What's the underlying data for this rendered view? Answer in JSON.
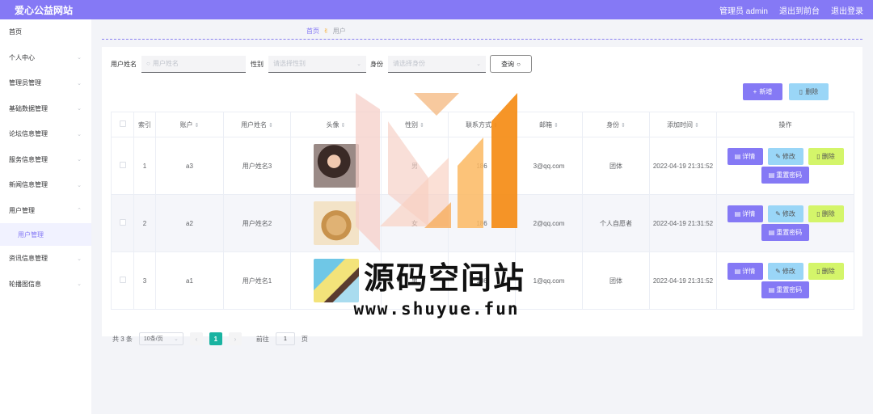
{
  "header": {
    "site_title": "爱心公益网站",
    "admin": "管理员 admin",
    "to_front": "退出到前台",
    "logout": "退出登录"
  },
  "sidebar": {
    "items": [
      {
        "label": "首页"
      },
      {
        "label": "个人中心"
      },
      {
        "label": "管理员管理"
      },
      {
        "label": "基础数据管理"
      },
      {
        "label": "论坛信息管理"
      },
      {
        "label": "服务信息管理"
      },
      {
        "label": "新闻信息管理"
      },
      {
        "label": "用户管理"
      },
      {
        "label": "用户管理"
      },
      {
        "label": "资讯信息管理"
      },
      {
        "label": "轮播图信息"
      }
    ]
  },
  "breadcrumb": {
    "home": "首页",
    "current": "用户"
  },
  "search": {
    "name_label": "用户姓名",
    "name_placeholder": "用户姓名",
    "gender_label": "性别",
    "gender_placeholder": "请选择性别",
    "role_label": "身份",
    "role_placeholder": "请选择身份",
    "query_button": "查询"
  },
  "toolbar": {
    "add": "新增",
    "delete": "删除"
  },
  "table": {
    "headers": [
      "索引",
      "账户",
      "用户姓名",
      "头像",
      "性别",
      "联系方式",
      "邮箱",
      "身份",
      "添加时间",
      "操作"
    ],
    "rows": [
      {
        "index": "1",
        "account": "a3",
        "name": "用户姓名3",
        "gender": "男",
        "phone": "186",
        "email": "3@qq.com",
        "role": "团体",
        "time": "2022-04-19 21:31:52"
      },
      {
        "index": "2",
        "account": "a2",
        "name": "用户姓名2",
        "gender": "女",
        "phone": "186",
        "email": "2@qq.com",
        "role": "个人自愿者",
        "time": "2022-04-19 21:31:52"
      },
      {
        "index": "3",
        "account": "a1",
        "name": "用户姓名1",
        "gender": "男",
        "phone": "186",
        "email": "1@qq.com",
        "role": "团体",
        "time": "2022-04-19 21:31:52"
      }
    ],
    "ops": {
      "detail": "详情",
      "edit": "修改",
      "delete": "删除",
      "reset": "重置密码"
    }
  },
  "pager": {
    "total": "共 3 条",
    "page_size": "10条/页",
    "current": "1",
    "goto_label": "前往",
    "goto_value": "1",
    "page_unit": "页"
  },
  "watermark": {
    "title": "源码空间站",
    "url": "www.shuyue.fun"
  },
  "colors": {
    "accent": "#8579f5",
    "page_active": "#19b3a1",
    "delete_btn": "#d4f56a",
    "edit_btn": "#9ad6f7"
  }
}
